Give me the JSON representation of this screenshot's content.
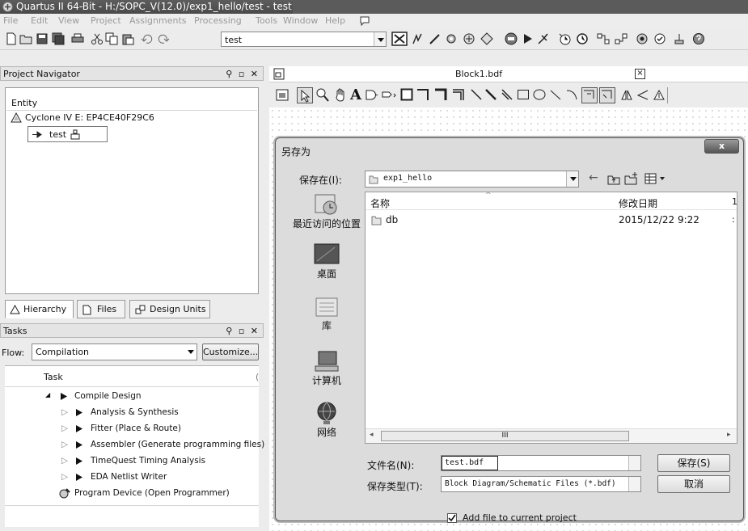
{
  "window": {
    "title": "Quartus II 64-Bit - H:/SOPC_V(12.0)/exp1_hello/test - test"
  },
  "menu": [
    "File",
    "Edit",
    "View",
    "Project",
    "Assignments",
    "Processing",
    "Tools",
    "Window",
    "Help"
  ],
  "toolbar": {
    "project_combo": "test"
  },
  "project_navigator": {
    "title": "Project Navigator",
    "column": "Entity",
    "device": "Cyclone IV E: EP4CE40F29C6",
    "entity": "test",
    "tabs": [
      "Hierarchy",
      "Files",
      "Design Units"
    ]
  },
  "tasks": {
    "title": "Tasks",
    "flow_label": "Flow:",
    "flow_value": "Compilation",
    "customize": "Customize...",
    "column": "Task",
    "items": [
      "Compile Design",
      "Analysis & Synthesis",
      "Fitter (Place & Route)",
      "Assembler (Generate programming files)",
      "TimeQuest Timing Analysis",
      "EDA Netlist Writer",
      "Program Device (Open Programmer)"
    ]
  },
  "editor": {
    "tab": "Block1.bdf"
  },
  "dialog": {
    "title": "另存为",
    "close": "x",
    "save_in_label": "保存在(I):",
    "save_in_value": "exp1_hello",
    "places": [
      "最近访问的位置",
      "桌面",
      "库",
      "计算机",
      "网络"
    ],
    "columns": {
      "name": "名称",
      "modified": "修改日期",
      "extra": "1"
    },
    "files": [
      {
        "name": "db",
        "modified": "2015/12/22 9:22",
        "extra": ":"
      }
    ],
    "scroll_thumb": "III",
    "filename_label": "文件名(N):",
    "filename_value": "test.bdf",
    "filetype_label": "保存类型(T):",
    "filetype_value": "Block Diagram/Schematic Files (*.bdf)",
    "save_button": "保存(S)",
    "cancel_button": "取消",
    "add_file_label": "Add file to current project",
    "add_file_checked": true
  }
}
